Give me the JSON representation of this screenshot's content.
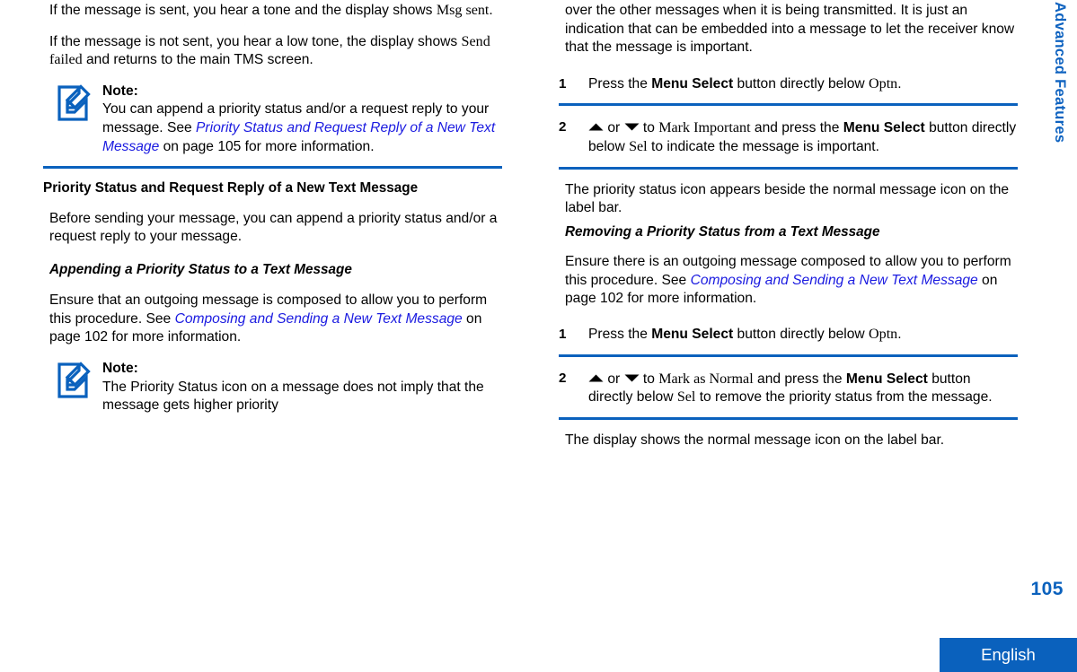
{
  "document": {
    "section_tab": "Advanced Features",
    "page_number": "105",
    "language": "English",
    "note_label": "Note:",
    "icon_names": {
      "note": "note-edit-icon",
      "arrow_up": "arrow-up-icon",
      "arrow_down": "arrow-down-icon"
    },
    "colors": {
      "rule_blue": "#0a61bd",
      "tab_blue": "#0f63c0",
      "link_blue": "#1a1ae0",
      "footer_blue": "#0a61bd",
      "text_black": "#000000"
    }
  },
  "left_column": {
    "p1": {
      "a": "If the message is sent, you hear a tone and the display shows ",
      "screen": "Msg sent",
      "b": "."
    },
    "p2": {
      "a": "If the message is not sent, you hear a low tone, the display shows ",
      "screen": "Send failed",
      "b": " and returns to the main TMS screen."
    },
    "note1": {
      "title": "Note:",
      "a": "You can append a priority status and/or a request reply to your message. See ",
      "link": "Priority Status and Request Reply of a New Text Message",
      "b": " on page 105 for more information."
    },
    "heading_section": "Priority Status and Request Reply of a New Text Message",
    "p3": "Before sending your message, you can append a priority status and/or a request reply to your message.",
    "heading_sub": "Appending a Priority Status to a Text Message",
    "p4": {
      "a": "Ensure that an outgoing message is composed to allow you to perform this procedure. See ",
      "link": "Composing and Sending a New Text Message",
      "b": " on page 102 for more information."
    },
    "note2": {
      "title": "Note:",
      "text": "The Priority Status icon on a message does not imply that the message gets higher priority"
    }
  },
  "right_column": {
    "p1": "over the other messages when it is being transmitted. It is just an indication that can be embedded into a message to let the receiver know that the message is important.",
    "steps_a": [
      {
        "num": "1",
        "a": "Press the ",
        "ui": "Menu Select",
        "b": " button directly below ",
        "screen": "Optn",
        "c": "."
      },
      {
        "num": "2",
        "a": "",
        "arrow_up": "▲",
        "mid1": " or ",
        "arrow_down": "▼",
        "mid2": " to ",
        "screen1": "Mark Important",
        "mid3": " and press the ",
        "ui": "Menu Select",
        "mid4": " button directly below ",
        "screen2": "Sel",
        "c": " to indicate the message is important."
      }
    ],
    "p2": "The priority status icon appears beside the normal message icon on the label bar.",
    "heading_sub": "Removing a Priority Status from a Text Message",
    "p3": {
      "a": "Ensure there is an outgoing message composed to allow you to perform this procedure. See ",
      "link": "Composing and Sending a New Text Message",
      "b": " on page 102 for more information."
    },
    "steps_b": [
      {
        "num": "1",
        "a": "Press the ",
        "ui": "Menu Select",
        "b": " button directly below ",
        "screen": "Optn",
        "c": "."
      },
      {
        "num": "2",
        "a": "",
        "arrow_up": "▲",
        "mid1": " or ",
        "arrow_down": "▼",
        "mid2": " to ",
        "screen1": "Mark as Normal",
        "mid3": " and press the ",
        "ui": "Menu Select",
        "mid4": " button directly below ",
        "screen2": "Sel",
        "c": " to remove the priority status from the message."
      }
    ],
    "p4": "The display shows the normal message icon on the label bar."
  }
}
